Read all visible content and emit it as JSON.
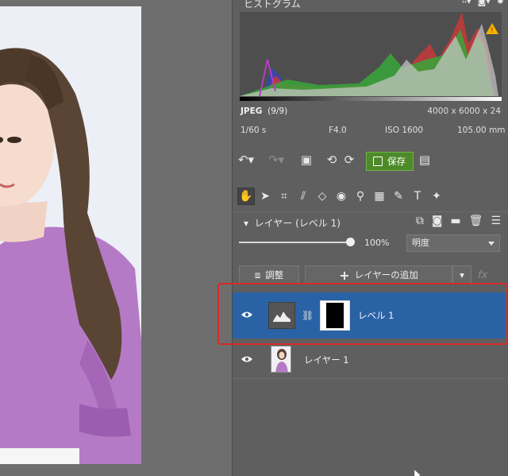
{
  "histogram": {
    "title": "ヒストグラム",
    "warning_icon": "warning-icon"
  },
  "file_info": {
    "format": "JPEG",
    "index": "(9/9)",
    "dimensions": "4000 x 6000 x 24"
  },
  "exif": {
    "shutter": "1/60 s",
    "aperture": "F4.0",
    "iso": "ISO 1600",
    "focal_length": "105.00 mm"
  },
  "toolbar": {
    "save_label": "保存"
  },
  "layers_panel": {
    "title": "レイヤー (レベル 1)",
    "opacity": "100%",
    "opacity_fraction": 1.0,
    "blend_mode": "明度",
    "adjust_label": "調整",
    "add_layer_label": "レイヤーの追加",
    "fx_label": "fx",
    "layers": [
      {
        "name": "レベル 1",
        "selected": true,
        "type": "adjustment"
      },
      {
        "name": "レイヤー 1",
        "selected": false,
        "type": "image"
      }
    ]
  },
  "colors": {
    "selected_layer": "#2a62a6",
    "save_button": "#4e8a2a",
    "highlight_outline": "#d62a2a"
  }
}
